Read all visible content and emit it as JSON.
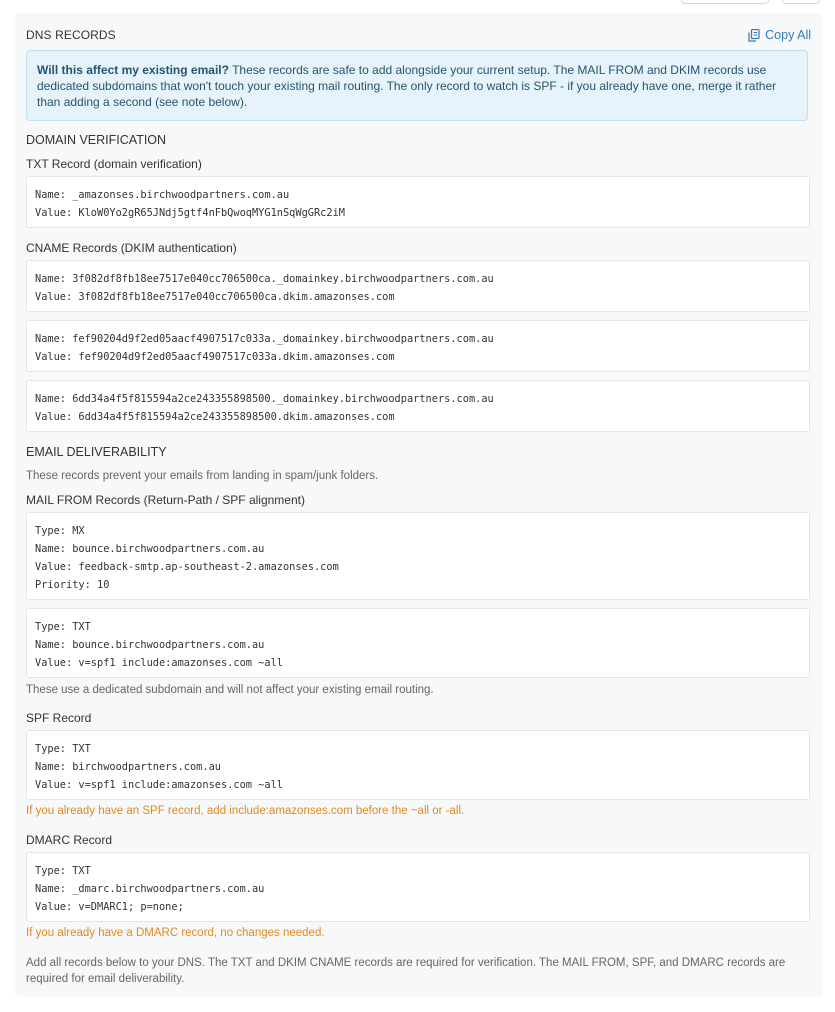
{
  "header": {
    "title": "DNS RECORDS",
    "copy_all_label": "Copy All",
    "copy_icon": "copy-icon"
  },
  "info": {
    "bold": "Will this affect my existing email?",
    "text": " These records are safe to add alongside your current setup. The MAIL FROM and DKIM records use dedicated subdomains that won't touch your existing mail routing. The only record to watch is SPF - if you already have one, merge it rather than adding a second (see note below)."
  },
  "domain_verification": {
    "heading": "DOMAIN VERIFICATION",
    "txt_heading": "TXT Record (domain verification)",
    "txt_record": {
      "name": "Name: _amazonses.birchwoodpartners.com.au",
      "value": "Value: KloW0Yo2gR65JNdj5gtf4nFbQwoqMYG1nSqWgGRc2iM"
    },
    "cname_heading": "CNAME Records (DKIM authentication)",
    "cname_records": [
      {
        "name": "Name: 3f082df8fb18ee7517e040cc706500ca._domainkey.birchwoodpartners.com.au",
        "value": "Value: 3f082df8fb18ee7517e040cc706500ca.dkim.amazonses.com"
      },
      {
        "name": "Name: fef90204d9f2ed05aacf4907517c033a._domainkey.birchwoodpartners.com.au",
        "value": "Value: fef90204d9f2ed05aacf4907517c033a.dkim.amazonses.com"
      },
      {
        "name": "Name: 6dd34a4f5f815594a2ce243355898500._domainkey.birchwoodpartners.com.au",
        "value": "Value: 6dd34a4f5f815594a2ce243355898500.dkim.amazonses.com"
      }
    ]
  },
  "deliverability": {
    "heading": "EMAIL DELIVERABILITY",
    "intro": "These records prevent your emails from landing in spam/junk folders.",
    "mailfrom_heading": "MAIL FROM Records (Return-Path / SPF alignment)",
    "mailfrom_mx": {
      "type": "Type: MX",
      "name": "Name: bounce.birchwoodpartners.com.au",
      "value": "Value: feedback-smtp.ap-southeast-2.amazonses.com",
      "priority": "Priority: 10"
    },
    "mailfrom_txt": {
      "type": "Type: TXT",
      "name": "Name: bounce.birchwoodpartners.com.au",
      "value": "Value: v=spf1 include:amazonses.com ~all"
    },
    "mailfrom_note": "These use a dedicated subdomain and will not affect your existing email routing.",
    "spf_heading": "SPF Record",
    "spf": {
      "type": "Type: TXT",
      "name": "Name: birchwoodpartners.com.au",
      "value": "Value: v=spf1 include:amazonses.com ~all"
    },
    "spf_warning": "If you already have an SPF record, add include:amazonses.com before the ~all or -all.",
    "dmarc_heading": "DMARC Record",
    "dmarc": {
      "type": "Type: TXT",
      "name": "Name: _dmarc.birchwoodpartners.com.au",
      "value": "Value: v=DMARC1; p=none;"
    },
    "dmarc_warning": "If you already have a DMARC record, no changes needed."
  },
  "footer": "Add all records below to your DNS. The TXT and DKIM CNAME records are required for verification. The MAIL FROM, SPF, and DMARC records are required for email deliverability.",
  "colors": {
    "accent": "#337ab7",
    "info_bg": "#e6f3fa",
    "warning": "#e08a1e"
  }
}
